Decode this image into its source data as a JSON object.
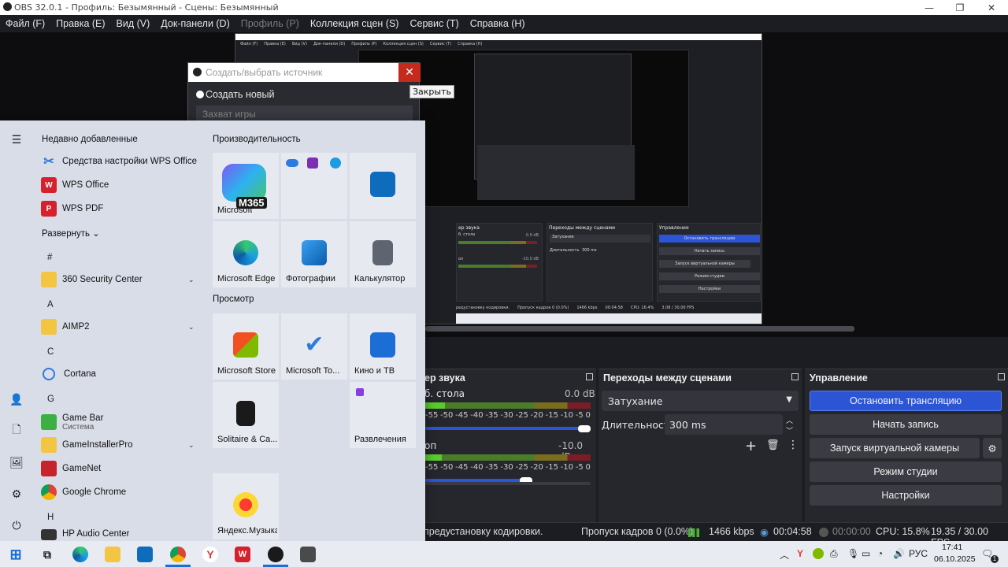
{
  "window": {
    "title": "OBS 32.0.1 - Профиль: Безымянный - Сцены: Безымянный"
  },
  "menu": [
    "Файл (F)",
    "Правка (E)",
    "Вид (V)",
    "Док-панели (D)",
    "Профиль (P)",
    "Коллекция сцен (S)",
    "Сервис (T)",
    "Справка (H)"
  ],
  "popup": {
    "placeholder": "Создать/выбрать источник",
    "create_new": "Создать новый",
    "name_value": "Захват игры",
    "close_tooltip": "Закрыть"
  },
  "audio_mixer": {
    "title": "ер звука",
    "ch1_name": "б. стола",
    "ch1_db": "0.0 dB",
    "ch2_name": "оп",
    "ch2_db": "-10.0 dB",
    "ticks": [
      "-55",
      "-50",
      "-45",
      "-40",
      "-35",
      "-30",
      "-25",
      "-20",
      "-15",
      "-10",
      "-5",
      "0"
    ],
    "ch1_level": 0.12,
    "ch2_level": 0.1
  },
  "transitions": {
    "title": "Переходы между сценами",
    "selected": "Затухание",
    "duration_label": "Длительность",
    "duration_value": "300 ms"
  },
  "controls": {
    "title": "Управление",
    "stop_stream": "Остановить трансляцию",
    "start_record": "Начать запись",
    "virtual_cam": "Запуск виртуальной камеры",
    "studio_mode": "Режим студии",
    "settings": "Настройки"
  },
  "status": {
    "message": "предустановку кодировки.",
    "dropped": "Пропуск кадров 0 (0.0%)",
    "bitrate": "1466 kbps",
    "stream_time": "00:04:58",
    "rec_time": "00:00:00",
    "cpu": "CPU: 15.8%",
    "fps": "19.35 / 30.00 FPS"
  },
  "start_menu": {
    "recent_header": "Недавно добавленные",
    "recent": [
      "Средства настройки WPS Office",
      "WPS Office",
      "WPS PDF"
    ],
    "expand": "Развернуть",
    "groups": [
      {
        "letter": "#"
      },
      {
        "letter": "A"
      },
      {
        "letter": "C"
      },
      {
        "letter": "G"
      },
      {
        "letter": "H"
      }
    ],
    "apps": [
      "360 Security Center",
      "AIMP2",
      "Cortana",
      "Game Bar",
      "Система",
      "GameInstallerPro",
      "GameNet",
      "Google Chrome",
      "HP Audio Center"
    ],
    "productivity_header": "Производительность",
    "browse_header": "Просмотр",
    "tiles": [
      "Microsoft 365",
      "M365",
      "Microsoft Edge",
      "Фотографии",
      "Калькулятор",
      "Microsoft Store",
      "Microsoft To...",
      "Кино и ТВ",
      "Solitaire & Ca...",
      "Развлечения",
      "Яндекс.Музыка"
    ]
  },
  "taskbar": {
    "lang": "РУС",
    "time": "17:41",
    "date": "06.10.2025",
    "notif": "1"
  },
  "nested": {
    "menu": [
      "Файл (F)",
      "Правка (E)",
      "Вид (V)",
      "Док-панели (D)",
      "Профиль (P)",
      "Коллекция сцен (S)",
      "Сервис (T)",
      "Справка (H)"
    ],
    "controls": [
      "Остановить трансляцию",
      "Начать запись",
      "Запуск виртуальной камеры",
      "Режим студии",
      "Настройки"
    ],
    "status": [
      "Пропуск кадров 0 (0.0%)",
      "1466 kbps",
      "00:04:58",
      "CPU: 16.4%",
      "3.08 / 30.00 FPS"
    ],
    "mixer_title": "ер звука",
    "trans_title": "Переходы между сценами",
    "controls_title": "Управление",
    "trans_value": "Затухание",
    "dur_label": "Длительность",
    "dur_value": "300 ms",
    "ch1": "б. стола",
    "ch2": "оп",
    "ch1_db": "0.0 dB",
    "ch2_db": "-10.0 dB",
    "msg": "редустановку кодировки."
  }
}
